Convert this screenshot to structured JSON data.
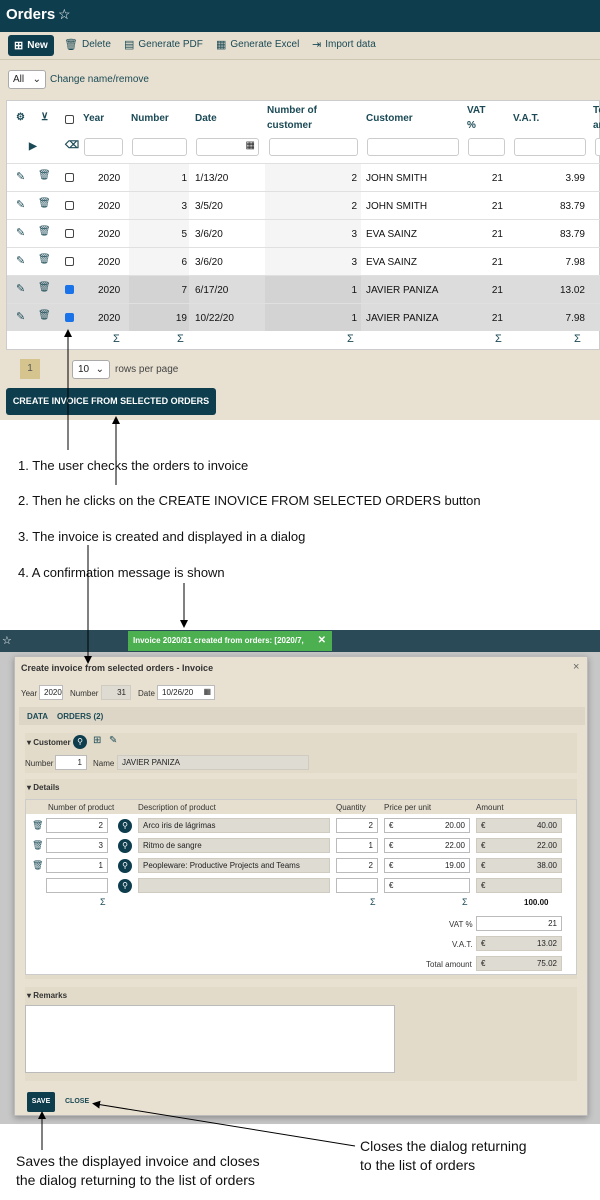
{
  "header": {
    "title": "Orders",
    "star_icon": "☆"
  },
  "toolbar": {
    "new": "New",
    "delete": "Delete",
    "pdf": "Generate PDF",
    "excel": "Generate Excel",
    "import": "Import data"
  },
  "list": {
    "filter_value": "All",
    "change_link": "Change name/remove",
    "columns": [
      "Year",
      "Number",
      "Date",
      "Number of",
      "customer",
      "Customer",
      "VAT",
      "%",
      "V.A.T.",
      "To",
      "an"
    ],
    "rows": [
      {
        "year": "2020",
        "number": "1",
        "date": "1/13/20",
        "customers": "2",
        "customer": "JOHN SMITH",
        "vat_pct": "21",
        "vat": "3.99",
        "selected": false
      },
      {
        "year": "2020",
        "number": "3",
        "date": "3/5/20",
        "customers": "2",
        "customer": "JOHN SMITH",
        "vat_pct": "21",
        "vat": "83.79",
        "selected": false
      },
      {
        "year": "2020",
        "number": "5",
        "date": "3/6/20",
        "customers": "3",
        "customer": "EVA SAINZ",
        "vat_pct": "21",
        "vat": "83.79",
        "selected": false
      },
      {
        "year": "2020",
        "number": "6",
        "date": "3/6/20",
        "customers": "3",
        "customer": "EVA SAINZ",
        "vat_pct": "21",
        "vat": "7.98",
        "selected": false
      },
      {
        "year": "2020",
        "number": "7",
        "date": "6/17/20",
        "customers": "1",
        "customer": "JAVIER PANIZA",
        "vat_pct": "21",
        "vat": "13.02",
        "selected": true
      },
      {
        "year": "2020",
        "number": "19",
        "date": "10/22/20",
        "customers": "1",
        "customer": "JAVIER PANIZA",
        "vat_pct": "21",
        "vat": "7.98",
        "selected": true
      }
    ],
    "sigma": "Σ",
    "page": "1",
    "rows_per_page": "10",
    "rows_per_page_label": "rows per page",
    "create_button": "CREATE INVOICE FROM SELECTED ORDERS"
  },
  "annotations": {
    "a1": "1. The user checks the orders to invoice",
    "a2": "2. Then he clicks on the CREATE INOVICE FROM SELECTED ORDERS button",
    "a3": "3. The invoice is created and displayed in a dialog",
    "a4": "4. A confirmation message is shown",
    "save_note_1": "Saves the displayed invoice and closes",
    "save_note_2": "the dialog returning to the list of orders",
    "close_note_1": "Closes the dialog returning",
    "close_note_2": "to the list of orders"
  },
  "toast": {
    "text": "Invoice 2020/31 created from orders: [2020/7, 2020/19]",
    "close": "✕"
  },
  "dialog": {
    "title": "Create invoice from selected orders - Invoice",
    "close": "×",
    "year_label": "Year",
    "year": "2020",
    "number_label": "Number",
    "number": "31",
    "date_label": "Date",
    "date": "10/26/20",
    "tab_data": "DATA",
    "tab_orders": "ORDERS (2)",
    "customer_section": "Customer",
    "cust_number_label": "Number",
    "cust_number": "1",
    "cust_name_label": "Name",
    "cust_name": "JAVIER PANIZA",
    "details_section": "Details",
    "detail_cols": [
      "Number of product",
      "Description of product",
      "Quantity",
      "Price per unit",
      "Amount"
    ],
    "details": [
      {
        "product": "2",
        "description": "Arco iris de lágrimas",
        "qty": "2",
        "price": "20.00",
        "amount": "40.00"
      },
      {
        "product": "3",
        "description": "Ritmo de sangre",
        "qty": "1",
        "price": "22.00",
        "amount": "22.00"
      },
      {
        "product": "1",
        "description": "Peopleware: Productive Projects and Teams",
        "qty": "2",
        "price": "19.00",
        "amount": "38.00"
      }
    ],
    "currency": "€",
    "sum_total": "100.00",
    "vat_pct_label": "VAT %",
    "vat_pct": "21",
    "vat_label": "V.A.T.",
    "vat": "13.02",
    "total_label": "Total amount",
    "total": "75.02",
    "remarks_section": "Remarks",
    "save": "SAVE",
    "close_link": "CLOSE"
  }
}
